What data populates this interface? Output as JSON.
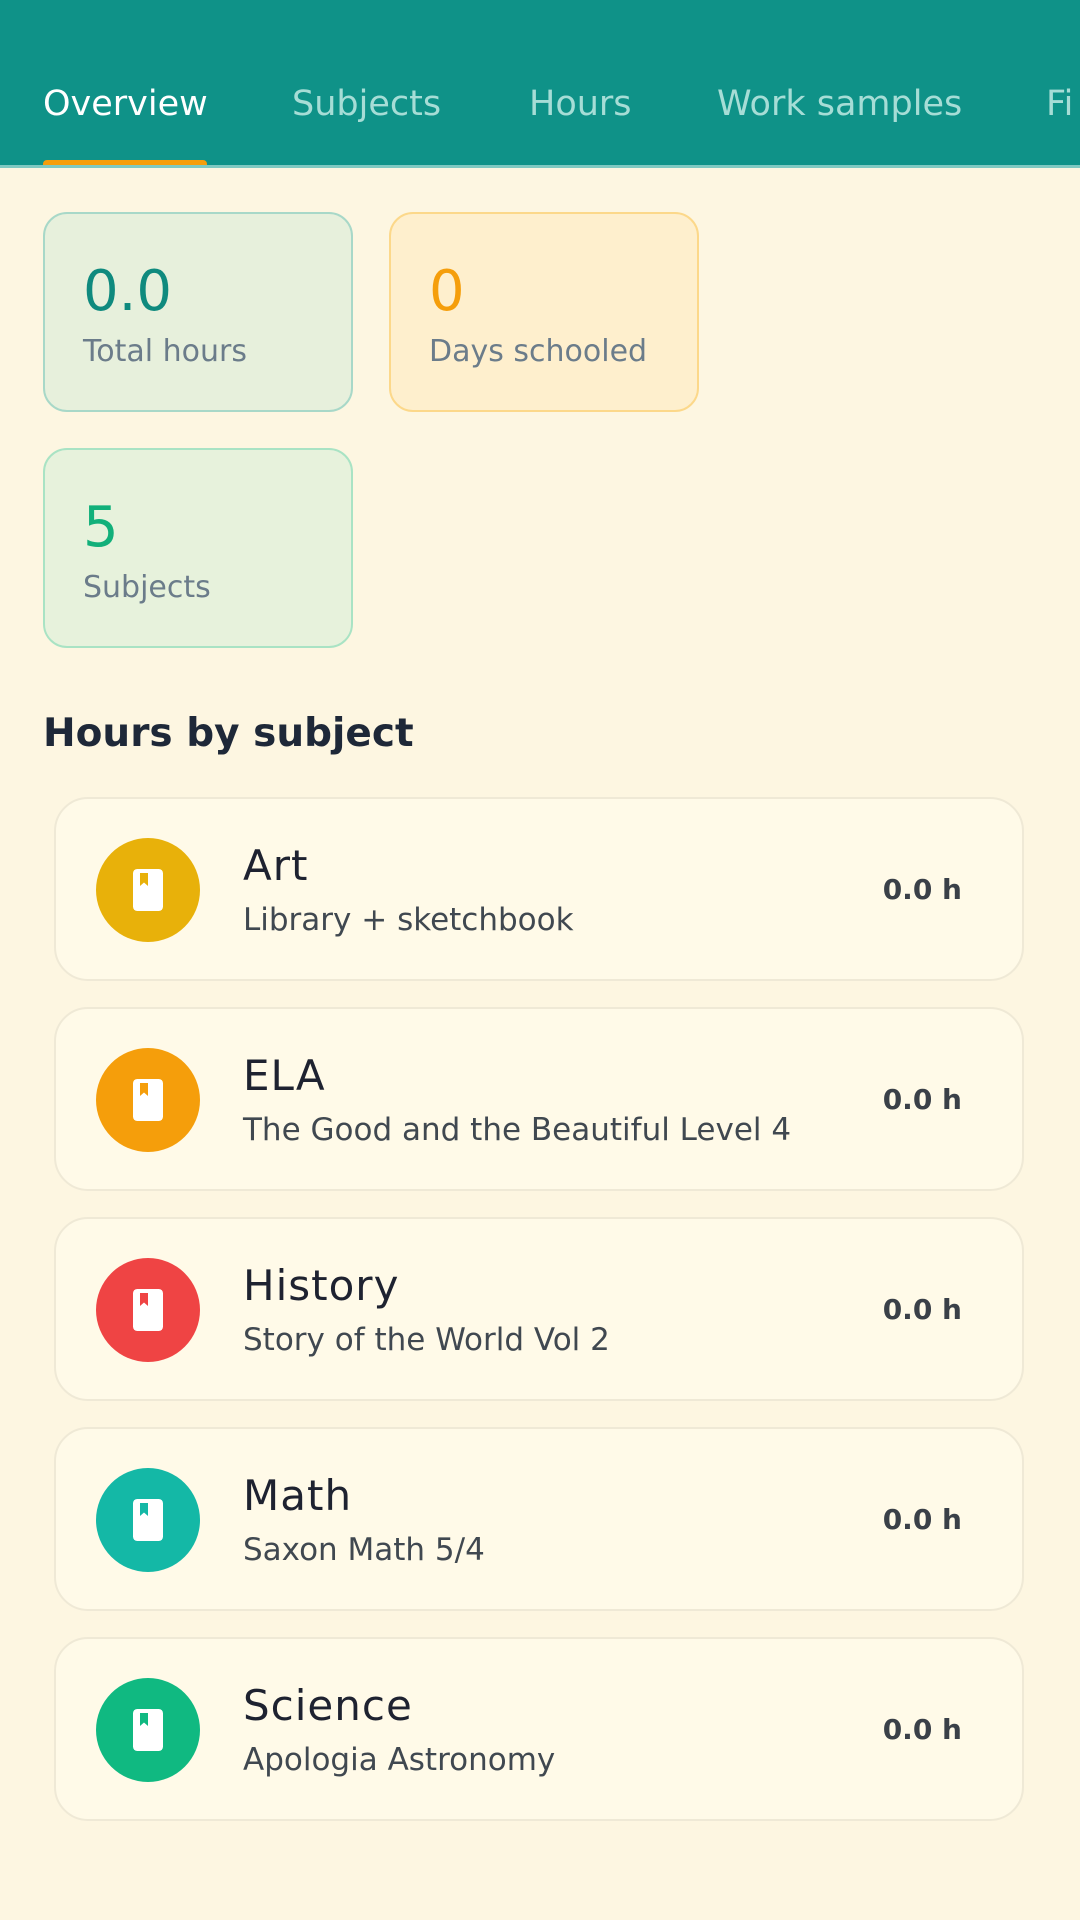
{
  "tabs": [
    {
      "label": "Overview",
      "active": true
    },
    {
      "label": "Subjects",
      "active": false
    },
    {
      "label": "Hours",
      "active": false
    },
    {
      "label": "Work samples",
      "active": false
    },
    {
      "label": "Fi",
      "active": false
    }
  ],
  "colors": {
    "header": "#0f9288",
    "tab_indicator": "#f59e0b",
    "background": "#fdf6e1"
  },
  "stats": {
    "total_hours": {
      "value": "0.0",
      "label": "Total hours",
      "color": "#0f8a7e"
    },
    "days_schooled": {
      "value": "0",
      "label": "Days schooled",
      "color": "#f59e0b"
    },
    "subjects": {
      "value": "5",
      "label": "Subjects",
      "color": "#12b07a"
    }
  },
  "section_title": "Hours by subject",
  "subjects": [
    {
      "name": "Art",
      "description": "Library + sketchbook",
      "hours": "0.0 h",
      "color": "#e8b10a",
      "icon": "book-icon"
    },
    {
      "name": "ELA",
      "description": "The Good and the Beautiful Level 4",
      "hours": "0.0 h",
      "color": "#f59e0b",
      "icon": "book-icon"
    },
    {
      "name": "History",
      "description": "Story of the World Vol 2",
      "hours": "0.0 h",
      "color": "#ef4444",
      "icon": "book-icon"
    },
    {
      "name": "Math",
      "description": "Saxon Math 5/4",
      "hours": "0.0 h",
      "color": "#14b8a6",
      "icon": "book-icon"
    },
    {
      "name": "Science",
      "description": "Apologia Astronomy",
      "hours": "0.0 h",
      "color": "#10b981",
      "icon": "book-icon"
    }
  ]
}
